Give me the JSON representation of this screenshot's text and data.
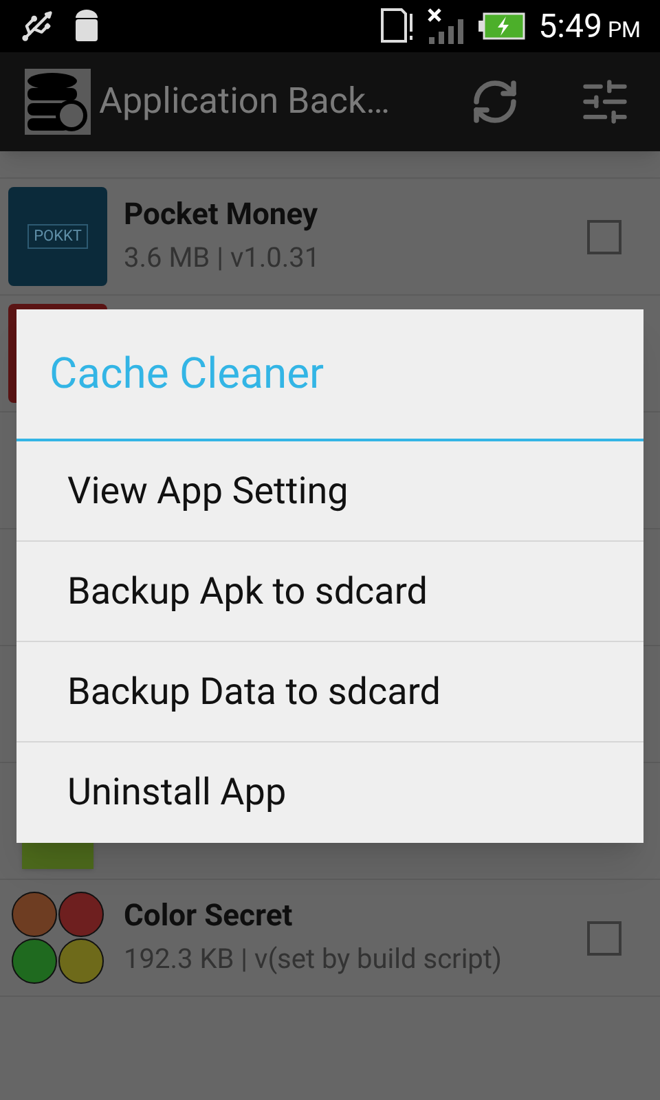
{
  "status_bar": {
    "time": "5:49",
    "period": "PM"
  },
  "action_bar": {
    "title": "Application Back…"
  },
  "apps": [
    {
      "name": "Pocket Money",
      "details": "3.6 MB | v1.0.31",
      "checked": false,
      "kind": "pokkt",
      "icon_label": "POKKT"
    },
    {
      "name": "Color Secret",
      "details": "192.3 KB | v(set by build script)",
      "checked": false,
      "kind": "balls"
    }
  ],
  "dialog": {
    "title": "Cache Cleaner",
    "items": [
      "View App Setting",
      "Backup Apk to sdcard",
      "Backup Data to sdcard",
      "Uninstall App"
    ]
  }
}
